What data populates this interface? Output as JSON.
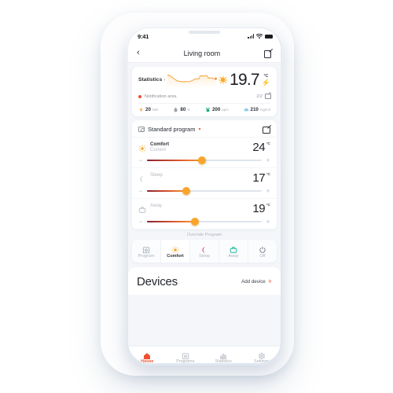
{
  "status_bar": {
    "time": "9:41",
    "signal_icon": "signal-bars-icon",
    "wifi_icon": "wifi-icon",
    "battery_icon": "battery-icon"
  },
  "header": {
    "back_icon": "chevron-left-icon",
    "title": "Living room",
    "edit_icon": "edit-square-icon"
  },
  "statistics": {
    "label": "Statistics",
    "arrow": "›",
    "sun_icon": "sun-icon",
    "temperature": "19.7",
    "unit": "°C",
    "bolt_icon": "lightning-bolt-icon",
    "sparkline_color": "#f7a94a",
    "notification": {
      "dot_color": "#ee4a35",
      "text": "Notification area.",
      "count": "2/2",
      "external_icon": "external-link-icon"
    },
    "metrics": [
      {
        "icon": "bolt-icon",
        "value": "20",
        "unit": "kwh",
        "color": "#f7a734"
      },
      {
        "icon": "droplet-icon",
        "value": "80",
        "unit": "%",
        "color": "#9aa3ad"
      },
      {
        "icon": "co2-icon",
        "value": "200",
        "unit": "ppm",
        "color": "#1faa78"
      },
      {
        "icon": "cloud-icon",
        "value": "210",
        "unit": "mg/m3",
        "color": "#8ecbe8"
      }
    ]
  },
  "program": {
    "calendar_icon": "calendar-icon",
    "name": "Standard program",
    "chevron_icon": "chevron-down-icon",
    "chevron_color": "#f0643a",
    "edit_icon": "edit-square-icon",
    "rows": [
      {
        "icon": "sun-icon",
        "title": "Comfort",
        "subtitle": "Current",
        "temp": "24",
        "unit": "°C",
        "percent": 48,
        "minus": "−",
        "plus": "+"
      },
      {
        "icon": "moon-icon",
        "title": "Sleep",
        "subtitle": "",
        "temp": "17",
        "unit": "°C",
        "percent": 34,
        "minus": "−",
        "plus": "+"
      },
      {
        "icon": "briefcase-icon",
        "title": "Away",
        "subtitle": "",
        "temp": "19",
        "unit": "°C",
        "percent": 42,
        "minus": "−",
        "plus": "+"
      }
    ]
  },
  "override": {
    "label": "Override Program",
    "tabs": [
      {
        "icon": "calendar-icon",
        "label": "Program",
        "active": false,
        "color": "#9aa6b5"
      },
      {
        "icon": "sun-icon",
        "label": "Comfort",
        "active": true,
        "color": "#f9a826"
      },
      {
        "icon": "moon-icon",
        "label": "Sleep",
        "active": false,
        "color": "#d4356b"
      },
      {
        "icon": "briefcase-icon",
        "label": "Away",
        "active": false,
        "color": "#16b498"
      },
      {
        "icon": "power-icon",
        "label": "Off",
        "active": false,
        "color": "#6b7280"
      }
    ]
  },
  "devices": {
    "title": "Devices",
    "add_label": "Add device",
    "add_icon": "plus-icon",
    "add_color": "#f0643a"
  },
  "bottom_nav": {
    "items": [
      {
        "icon": "house-icon",
        "label": "House",
        "active": true,
        "color": "#f0502e"
      },
      {
        "icon": "calendar-icon",
        "label": "Programs",
        "active": false,
        "color": "#b2b8c0"
      },
      {
        "icon": "bar-chart-icon",
        "label": "Statistics",
        "active": false,
        "color": "#b2b8c0"
      },
      {
        "icon": "gear-icon",
        "label": "Settings",
        "active": false,
        "color": "#b2b8c0"
      }
    ]
  }
}
